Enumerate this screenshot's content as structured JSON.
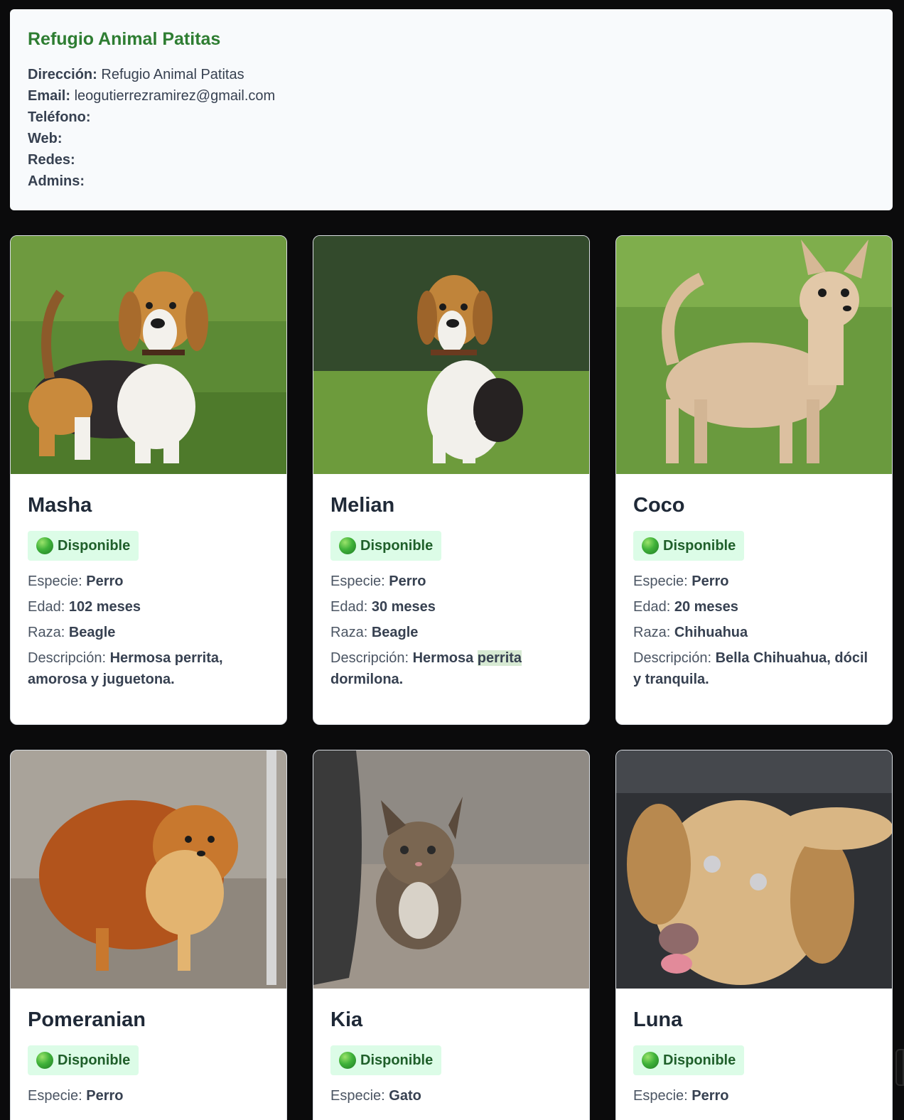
{
  "shelter": {
    "name": "Refugio Animal Patitas",
    "address_label": "Dirección:",
    "address": "Refugio Animal Patitas",
    "email_label": "Email:",
    "email": "leogutierrezramirez@gmail.com",
    "phone_label": "Teléfono:",
    "web_label": "Web:",
    "social_label": "Redes:",
    "admins_label": "Admins:"
  },
  "labels": {
    "species": "Especie:",
    "age": "Edad:",
    "breed": "Raza:",
    "description": "Descripción:"
  },
  "pets": [
    {
      "name": "Masha",
      "status": "Disponible",
      "species": "Perro",
      "age": "102 meses",
      "breed": "Beagle",
      "description": "Hermosa perrita, amorosa y juguetona.",
      "photo": "beagle-photo"
    },
    {
      "name": "Melian",
      "status": "Disponible",
      "species": "Perro",
      "age": "30 meses",
      "breed": "Beagle",
      "description_a": "Hermosa",
      "description_b": "perrita",
      "description_c": "dormilona.",
      "photo": "beagle-sitting-photo"
    },
    {
      "name": "Coco",
      "status": "Disponible",
      "species": "Perro",
      "age": "20 meses",
      "breed": "Chihuahua",
      "description": "Bella Chihuahua, dócil y tranquila.",
      "photo": "chihuahua-photo"
    },
    {
      "name": "Pomeranian",
      "status": "Disponible",
      "species": "Perro",
      "photo": "pomeranian-photo"
    },
    {
      "name": "Kia",
      "status": "Disponible",
      "species": "Gato",
      "photo": "kitten-photo"
    },
    {
      "name": "Luna",
      "status": "Disponible",
      "species": "Perro",
      "photo": "labrador-photo"
    }
  ]
}
